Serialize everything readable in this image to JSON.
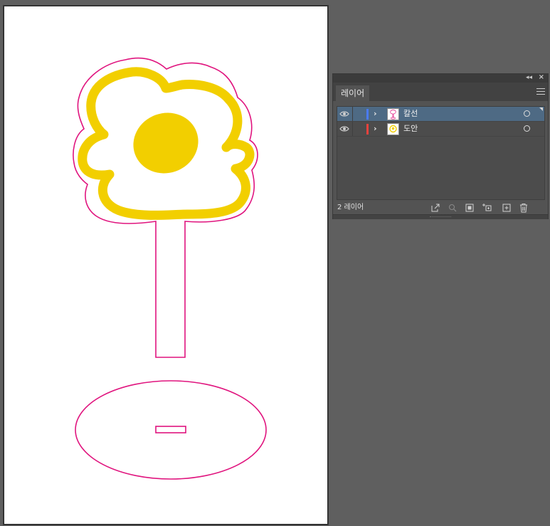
{
  "panel": {
    "tab_label": "레이어",
    "layer_count": "2 레이어",
    "layers": [
      {
        "name": "칼선",
        "color": "#4a7bf2",
        "selected": true
      },
      {
        "name": "도안",
        "color": "#e8423d",
        "selected": false
      }
    ],
    "footer_icons": [
      "export-icon",
      "search-icon",
      "clipping-mask-icon",
      "sublayer-icon",
      "new-layer-icon",
      "trash-icon"
    ]
  },
  "colors": {
    "cutline": "#e0147e",
    "flower_fill": "#f2cf00",
    "workspace": "#5f5f5f",
    "selection": "#4e6a84"
  }
}
